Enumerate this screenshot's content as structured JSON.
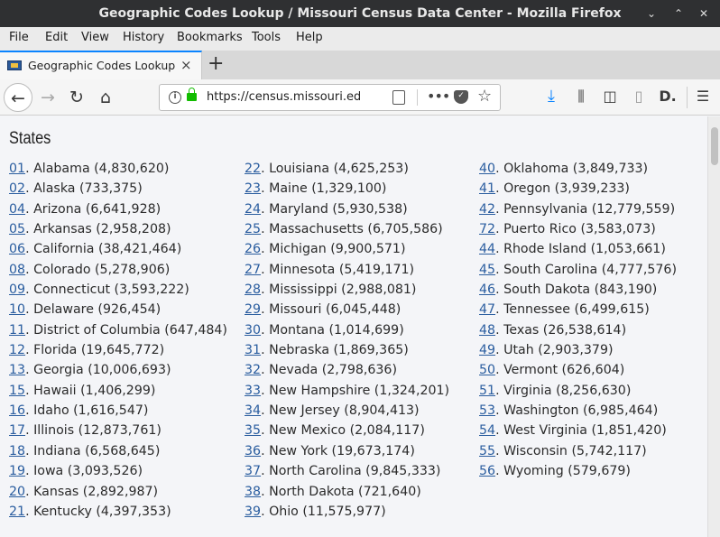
{
  "window": {
    "title": "Geographic Codes Lookup / Missouri Census Data Center - Mozilla Firefox"
  },
  "menu": [
    "File",
    "Edit",
    "View",
    "History",
    "Bookmarks",
    "Tools",
    "Help"
  ],
  "tab": {
    "title": "Geographic Codes Lookup / M",
    "close": "×",
    "new": "+"
  },
  "nav": {
    "url": "https://census.missouri.edu/ge"
  },
  "page": {
    "heading": "States"
  },
  "states": [
    [
      {
        "code": "01",
        "text": ". Alabama (4,830,620)"
      },
      {
        "code": "02",
        "text": ". Alaska (733,375)"
      },
      {
        "code": "04",
        "text": ". Arizona (6,641,928)"
      },
      {
        "code": "05",
        "text": ". Arkansas (2,958,208)"
      },
      {
        "code": "06",
        "text": ". California (38,421,464)"
      },
      {
        "code": "08",
        "text": ". Colorado (5,278,906)"
      },
      {
        "code": "09",
        "text": ". Connecticut (3,593,222)"
      },
      {
        "code": "10",
        "text": ". Delaware (926,454)"
      },
      {
        "code": "11",
        "text": ". District of Columbia (647,484)"
      },
      {
        "code": "12",
        "text": ". Florida (19,645,772)"
      },
      {
        "code": "13",
        "text": ". Georgia (10,006,693)"
      },
      {
        "code": "15",
        "text": ". Hawaii (1,406,299)"
      },
      {
        "code": "16",
        "text": ". Idaho (1,616,547)"
      },
      {
        "code": "17",
        "text": ". Illinois (12,873,761)"
      },
      {
        "code": "18",
        "text": ". Indiana (6,568,645)"
      },
      {
        "code": "19",
        "text": ". Iowa (3,093,526)"
      },
      {
        "code": "20",
        "text": ". Kansas (2,892,987)"
      },
      {
        "code": "21",
        "text": ". Kentucky (4,397,353)"
      }
    ],
    [
      {
        "code": "22",
        "text": ". Louisiana (4,625,253)"
      },
      {
        "code": "23",
        "text": ". Maine (1,329,100)"
      },
      {
        "code": "24",
        "text": ". Maryland (5,930,538)"
      },
      {
        "code": "25",
        "text": ". Massachusetts (6,705,586)"
      },
      {
        "code": "26",
        "text": ". Michigan (9,900,571)"
      },
      {
        "code": "27",
        "text": ". Minnesota (5,419,171)"
      },
      {
        "code": "28",
        "text": ". Mississippi (2,988,081)"
      },
      {
        "code": "29",
        "text": ". Missouri (6,045,448)"
      },
      {
        "code": "30",
        "text": ". Montana (1,014,699)"
      },
      {
        "code": "31",
        "text": ". Nebraska (1,869,365)"
      },
      {
        "code": "32",
        "text": ". Nevada (2,798,636)"
      },
      {
        "code": "33",
        "text": ". New Hampshire (1,324,201)"
      },
      {
        "code": "34",
        "text": ". New Jersey (8,904,413)"
      },
      {
        "code": "35",
        "text": ". New Mexico (2,084,117)"
      },
      {
        "code": "36",
        "text": ". New York (19,673,174)"
      },
      {
        "code": "37",
        "text": ". North Carolina (9,845,333)"
      },
      {
        "code": "38",
        "text": ". North Dakota (721,640)"
      },
      {
        "code": "39",
        "text": ". Ohio (11,575,977)"
      }
    ],
    [
      {
        "code": "40",
        "text": ". Oklahoma (3,849,733)"
      },
      {
        "code": "41",
        "text": ". Oregon (3,939,233)"
      },
      {
        "code": "42",
        "text": ". Pennsylvania (12,779,559)"
      },
      {
        "code": "72",
        "text": ". Puerto Rico (3,583,073)"
      },
      {
        "code": "44",
        "text": ". Rhode Island (1,053,661)"
      },
      {
        "code": "45",
        "text": ". South Carolina (4,777,576)"
      },
      {
        "code": "46",
        "text": ". South Dakota (843,190)"
      },
      {
        "code": "47",
        "text": ". Tennessee (6,499,615)"
      },
      {
        "code": "48",
        "text": ". Texas (26,538,614)"
      },
      {
        "code": "49",
        "text": ". Utah (2,903,379)"
      },
      {
        "code": "50",
        "text": ". Vermont (626,604)"
      },
      {
        "code": "51",
        "text": ". Virginia (8,256,630)"
      },
      {
        "code": "53",
        "text": ". Washington (6,985,464)"
      },
      {
        "code": "54",
        "text": ". West Virginia (1,851,420)"
      },
      {
        "code": "55",
        "text": ". Wisconsin (5,742,117)"
      },
      {
        "code": "56",
        "text": ". Wyoming (579,679)"
      }
    ]
  ]
}
